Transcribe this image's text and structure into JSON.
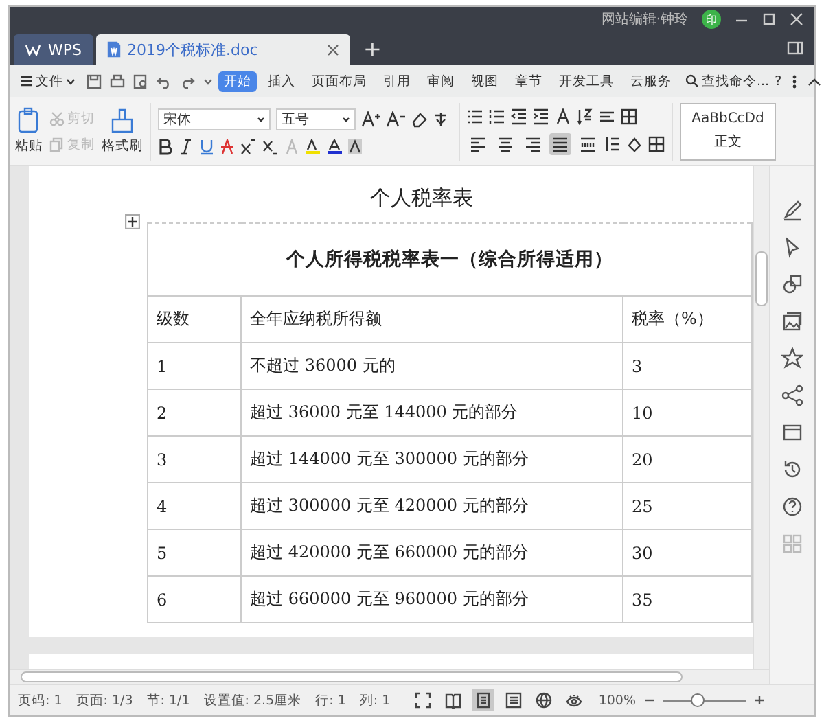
{
  "window": {
    "user": "网站编辑·钟玲",
    "avatar_initial": "印",
    "tabs": [
      {
        "label": "WPS",
        "kind": "home",
        "selected": false
      },
      {
        "label": "2019个税标准.doc",
        "kind": "doc",
        "selected": true
      }
    ],
    "new_tab": "+"
  },
  "menu": {
    "file": "文件",
    "items": [
      {
        "label": "开始",
        "selected": true
      },
      {
        "label": "插入",
        "selected": false
      },
      {
        "label": "页面布局",
        "selected": false
      },
      {
        "label": "引用",
        "selected": false
      },
      {
        "label": "审阅",
        "selected": false
      },
      {
        "label": "视图",
        "selected": false
      },
      {
        "label": "章节",
        "selected": false
      },
      {
        "label": "开发工具",
        "selected": false
      },
      {
        "label": "云服务",
        "selected": false
      }
    ],
    "search": "查找命令...",
    "help": "?"
  },
  "ribbon": {
    "paste": "粘贴",
    "cut": {
      "label": "剪切",
      "disabled": true
    },
    "copy": {
      "label": "复制",
      "disabled": true
    },
    "format_painter": "格式刷",
    "font": "宋体",
    "size": "五号",
    "alignment": [
      {
        "kind": "left",
        "selected": false
      },
      {
        "kind": "center",
        "selected": false
      },
      {
        "kind": "right",
        "selected": false
      },
      {
        "kind": "justify",
        "selected": true
      },
      {
        "kind": "distributed",
        "selected": false
      }
    ],
    "style_preview": "AaBbCcDd",
    "style_name": "正文"
  },
  "document": {
    "heading": "个人税率表",
    "table": {
      "title": "个人所得税税率表一（综合所得适用）",
      "columns": [
        "级数",
        "全年应纳税所得额",
        "税率（%）"
      ],
      "rows": [
        [
          "1",
          "不超过 36000 元的",
          "3"
        ],
        [
          "2",
          "超过 36000 元至 144000 元的部分",
          "10"
        ],
        [
          "3",
          "超过 144000 元至 300000 元的部分",
          "20"
        ],
        [
          "4",
          "超过 300000 元至 420000 元的部分",
          "25"
        ],
        [
          "5",
          "超过 420000 元至 660000 元的部分",
          "30"
        ],
        [
          "6",
          "超过 660000 元至 960000 元的部分",
          "35"
        ]
      ]
    }
  },
  "status_bar": {
    "items": [
      "页码: 1",
      "页面: 1/3",
      "节: 1/1",
      "设置值: 2.5厘米",
      "行: 1",
      "列: 1"
    ],
    "views": [
      {
        "kind": "fullscreen",
        "selected": false
      },
      {
        "kind": "reading",
        "selected": false
      },
      {
        "kind": "page",
        "selected": true
      },
      {
        "kind": "outline",
        "selected": false
      },
      {
        "kind": "web",
        "selected": false
      },
      {
        "kind": "eye",
        "selected": false
      }
    ],
    "zoom": "100%",
    "zoom_slider": {
      "level": 0.42
    }
  }
}
